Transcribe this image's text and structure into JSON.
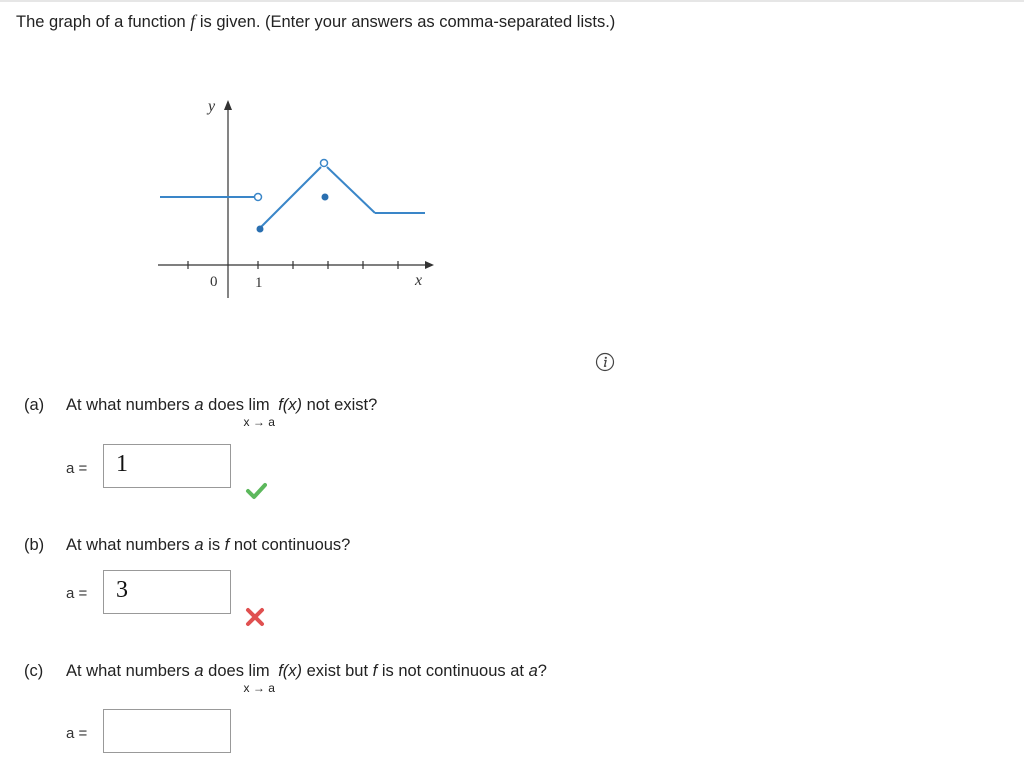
{
  "prompt": {
    "before_f": "The graph of a function ",
    "f": "f",
    "after_f": " is given. (Enter your answers as comma-separated lists.)"
  },
  "graph": {
    "y_axis_label": "y",
    "x_axis_label": "x",
    "tick_label_0": "0",
    "tick_label_1": "1",
    "line_color": "#3a86c8"
  },
  "icons": {
    "info": "info-icon",
    "correct": "check-icon",
    "incorrect": "cross-icon"
  },
  "parts": {
    "a": {
      "label": "(a)",
      "text_1": "At what numbers ",
      "var_a": "a",
      "text_2": " does ",
      "lim": "lim",
      "lim_sub": "x → a",
      "fx": "f(x)",
      "text_3": " not exist?",
      "answer_label": "a =",
      "answer_value": "1",
      "status": "correct"
    },
    "b": {
      "label": "(b)",
      "text_1": "At what numbers ",
      "var_a": "a",
      "text_2": " is ",
      "f": "f",
      "text_3": " not continuous?",
      "answer_label": "a =",
      "answer_value": "3",
      "status": "incorrect"
    },
    "c": {
      "label": "(c)",
      "text_1": "At what numbers ",
      "var_a": "a",
      "text_2": " does ",
      "lim": "lim",
      "lim_sub": "x → a",
      "fx": "f(x)",
      "text_3": " exist but ",
      "f": "f",
      "text_4": " is not continuous at ",
      "var_a2": "a",
      "text_5": "?",
      "answer_label": "a =",
      "answer_value": ""
    }
  },
  "colors": {
    "correct": "#5cb85c",
    "incorrect": "#e05050"
  }
}
